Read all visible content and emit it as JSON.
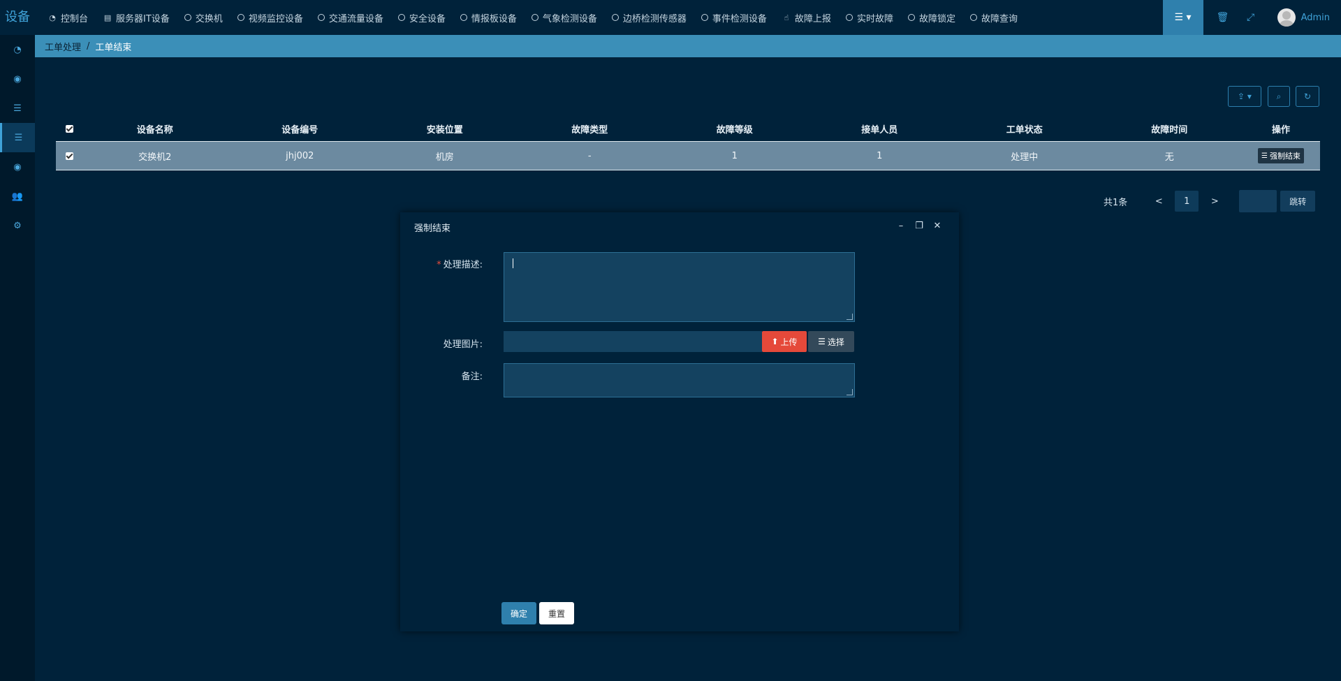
{
  "app": {
    "brand": "设备"
  },
  "nav": {
    "items": [
      {
        "label": "控制台",
        "icon": "dashboard-icon",
        "glyph": "◔"
      },
      {
        "label": "服务器IT设备",
        "icon": "server-icon",
        "glyph": "▤"
      },
      {
        "label": "交换机",
        "icon": "circle-icon"
      },
      {
        "label": "视频监控设备",
        "icon": "circle-icon"
      },
      {
        "label": "交通流量设备",
        "icon": "circle-icon"
      },
      {
        "label": "安全设备",
        "icon": "circle-icon"
      },
      {
        "label": "情报板设备",
        "icon": "circle-icon"
      },
      {
        "label": "气象检测设备",
        "icon": "circle-icon"
      },
      {
        "label": "边桥检测传感器",
        "icon": "circle-icon"
      },
      {
        "label": "事件检测设备",
        "icon": "circle-icon"
      },
      {
        "label": "故障上报",
        "icon": "hand-pointer-icon",
        "glyph": "☝"
      },
      {
        "label": "实时故障",
        "icon": "circle-icon"
      },
      {
        "label": "故障锁定",
        "icon": "circle-icon"
      },
      {
        "label": "故障查询",
        "icon": "circle-icon"
      }
    ],
    "user": "Admin"
  },
  "breadcrumb": {
    "parent": "工单处理",
    "separator": "/",
    "current": "工单结束"
  },
  "table": {
    "headers": [
      "设备名称",
      "设备编号",
      "安装位置",
      "故障类型",
      "故障等级",
      "接单人员",
      "工单状态",
      "故障时间",
      "操作"
    ],
    "rows": [
      {
        "cells": [
          "交换机2",
          "jhj002",
          "机房",
          "-",
          "1",
          "1",
          "处理中",
          "无"
        ],
        "action": "强制结束"
      }
    ]
  },
  "pagination": {
    "total": "共1条",
    "prev": "<",
    "current": "1",
    "next": ">",
    "jump_label": "跳转"
  },
  "dialog": {
    "title": "强制结束",
    "fields": {
      "desc_label": "处理描述:",
      "desc_required": "*",
      "image_label": "处理图片:",
      "upload_label": "上传",
      "choose_label": "选择",
      "remark_label": "备注:"
    },
    "confirm": "确定",
    "reset": "重置"
  },
  "colors": {
    "background": "#00223a",
    "accent": "#3fa2d8",
    "breadcrumb": "#3b8fb8",
    "danger": "#e5493a"
  }
}
